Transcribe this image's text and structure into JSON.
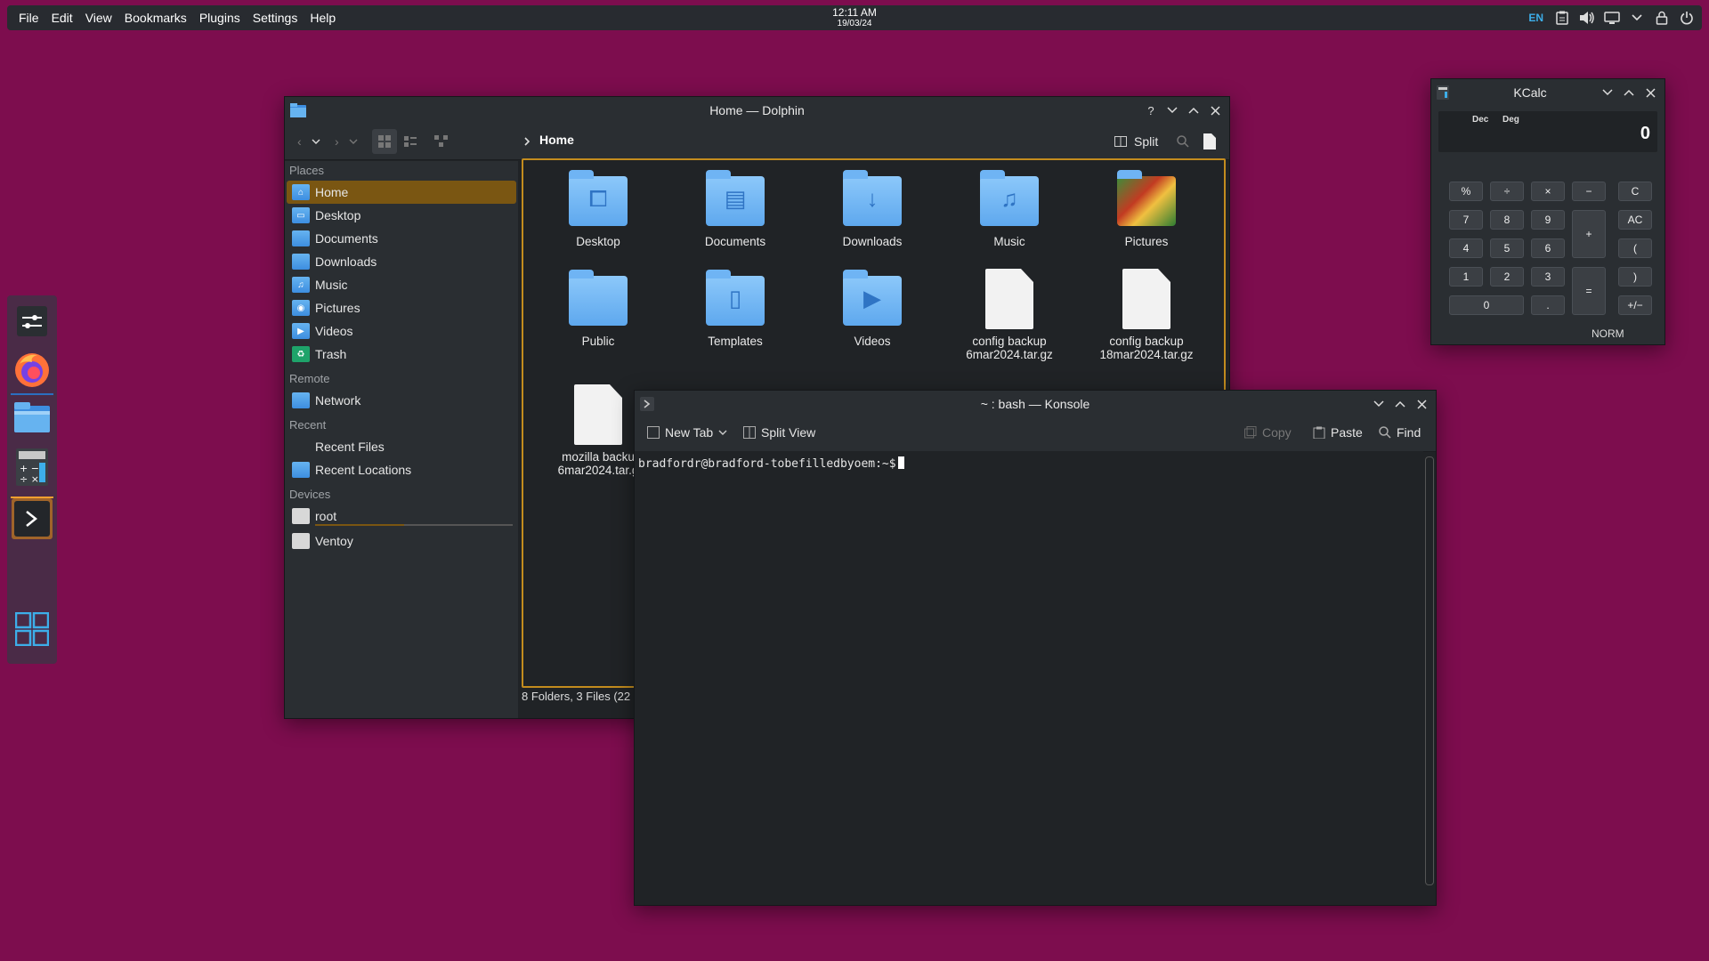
{
  "top_panel": {
    "menu": [
      "File",
      "Edit",
      "View",
      "Bookmarks",
      "Plugins",
      "Settings",
      "Help"
    ],
    "clock_time": "12:11 AM",
    "clock_date": "19/03/24",
    "lang": "EN",
    "tray_icons": [
      "clipboard-icon",
      "volume-icon",
      "display-icon",
      "chevron-down-icon",
      "lock-icon",
      "power-icon"
    ]
  },
  "dock": {
    "items": [
      "mixer-icon",
      "firefox-icon",
      "dolphin-icon",
      "kcalc-icon",
      "konsole-icon",
      "app-grid-icon"
    ]
  },
  "dolphin": {
    "title": "Home — Dolphin",
    "breadcrumb": "Home",
    "split_label": "Split",
    "places": {
      "places_header": "Places",
      "places_items": [
        "Home",
        "Desktop",
        "Documents",
        "Downloads",
        "Music",
        "Pictures",
        "Videos",
        "Trash"
      ],
      "remote_header": "Remote",
      "remote_items": [
        "Network"
      ],
      "recent_header": "Recent",
      "recent_items": [
        "Recent Files",
        "Recent Locations"
      ],
      "devices_header": "Devices",
      "devices_items": [
        "root",
        "Ventoy"
      ],
      "root_usage": 0.45
    },
    "files": [
      {
        "name": "Desktop",
        "kind": "folder"
      },
      {
        "name": "Documents",
        "kind": "folder"
      },
      {
        "name": "Downloads",
        "kind": "folder"
      },
      {
        "name": "Music",
        "kind": "folder"
      },
      {
        "name": "Pictures",
        "kind": "folder"
      },
      {
        "name": "Public",
        "kind": "folder"
      },
      {
        "name": "Templates",
        "kind": "folder"
      },
      {
        "name": "Videos",
        "kind": "folder"
      },
      {
        "name_line1": "config backup",
        "name_line2": "6mar2024.tar.gz",
        "kind": "file"
      },
      {
        "name_line1": "config backup",
        "name_line2": "18mar2024.tar.gz",
        "kind": "file"
      },
      {
        "name_line1": "mozilla backu",
        "name_line2": "6mar2024.tar.g",
        "kind": "file"
      }
    ],
    "status": "8 Folders, 3 Files (22"
  },
  "konsole": {
    "title": "~ : bash — Konsole",
    "toolbar": {
      "new_tab": "New Tab",
      "split_view": "Split View",
      "copy": "Copy",
      "paste": "Paste",
      "find": "Find"
    },
    "prompt": "bradfordr@bradford-tobefilledbyoem:~$"
  },
  "kcalc": {
    "title": "KCalc",
    "display": "0",
    "flag_dec": "Dec",
    "flag_deg": "Deg",
    "mode": "NORM",
    "keys": {
      "percent": "%",
      "divide": "÷",
      "multiply": "×",
      "minus": "−",
      "clear": "C",
      "seven": "7",
      "eight": "8",
      "nine": "9",
      "plus": "+",
      "all_clear": "AC",
      "four": "4",
      "five": "5",
      "six": "6",
      "open_paren": "(",
      "one": "1",
      "two": "2",
      "three": "3",
      "equals": "=",
      "close_paren": ")",
      "zero": "0",
      "decimal": ".",
      "sign": "+/−"
    }
  }
}
